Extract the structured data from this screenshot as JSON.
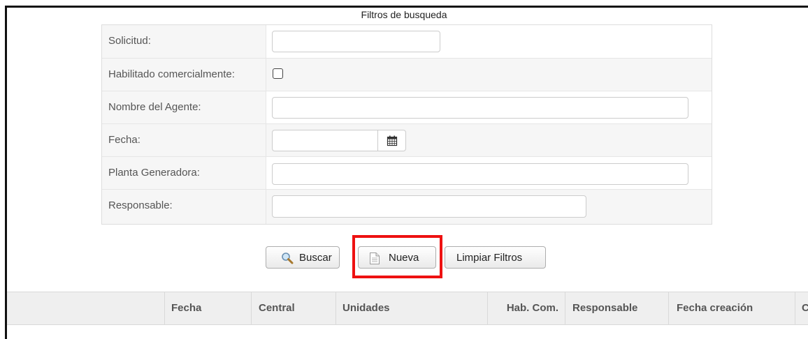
{
  "filters": {
    "title": "Filtros de busqueda",
    "rows": [
      {
        "label": "Solicitud:"
      },
      {
        "label": "Habilitado comercialmente:"
      },
      {
        "label": "Nombre del Agente:"
      },
      {
        "label": "Fecha:"
      },
      {
        "label": "Planta Generadora:"
      },
      {
        "label": "Responsable:"
      }
    ],
    "solicitud_value": "",
    "habilitado_checked": false,
    "agente_value": "",
    "fecha_value": "",
    "planta_value": "",
    "responsable_value": ""
  },
  "buttons": {
    "buscar": "Buscar",
    "nueva": "Nueva",
    "limpiar": "Limpiar Filtros"
  },
  "table": {
    "columns": [
      "",
      "Fecha",
      "Central",
      "Unidades",
      "Hab. Com.",
      "Responsable",
      "Fecha creación",
      "C"
    ]
  },
  "colors": {
    "highlight": "#ee1111",
    "header_bg": "#efefef"
  },
  "icons": {
    "calendar": "calendar-icon",
    "search": "magnifier-icon",
    "new": "document-icon"
  }
}
